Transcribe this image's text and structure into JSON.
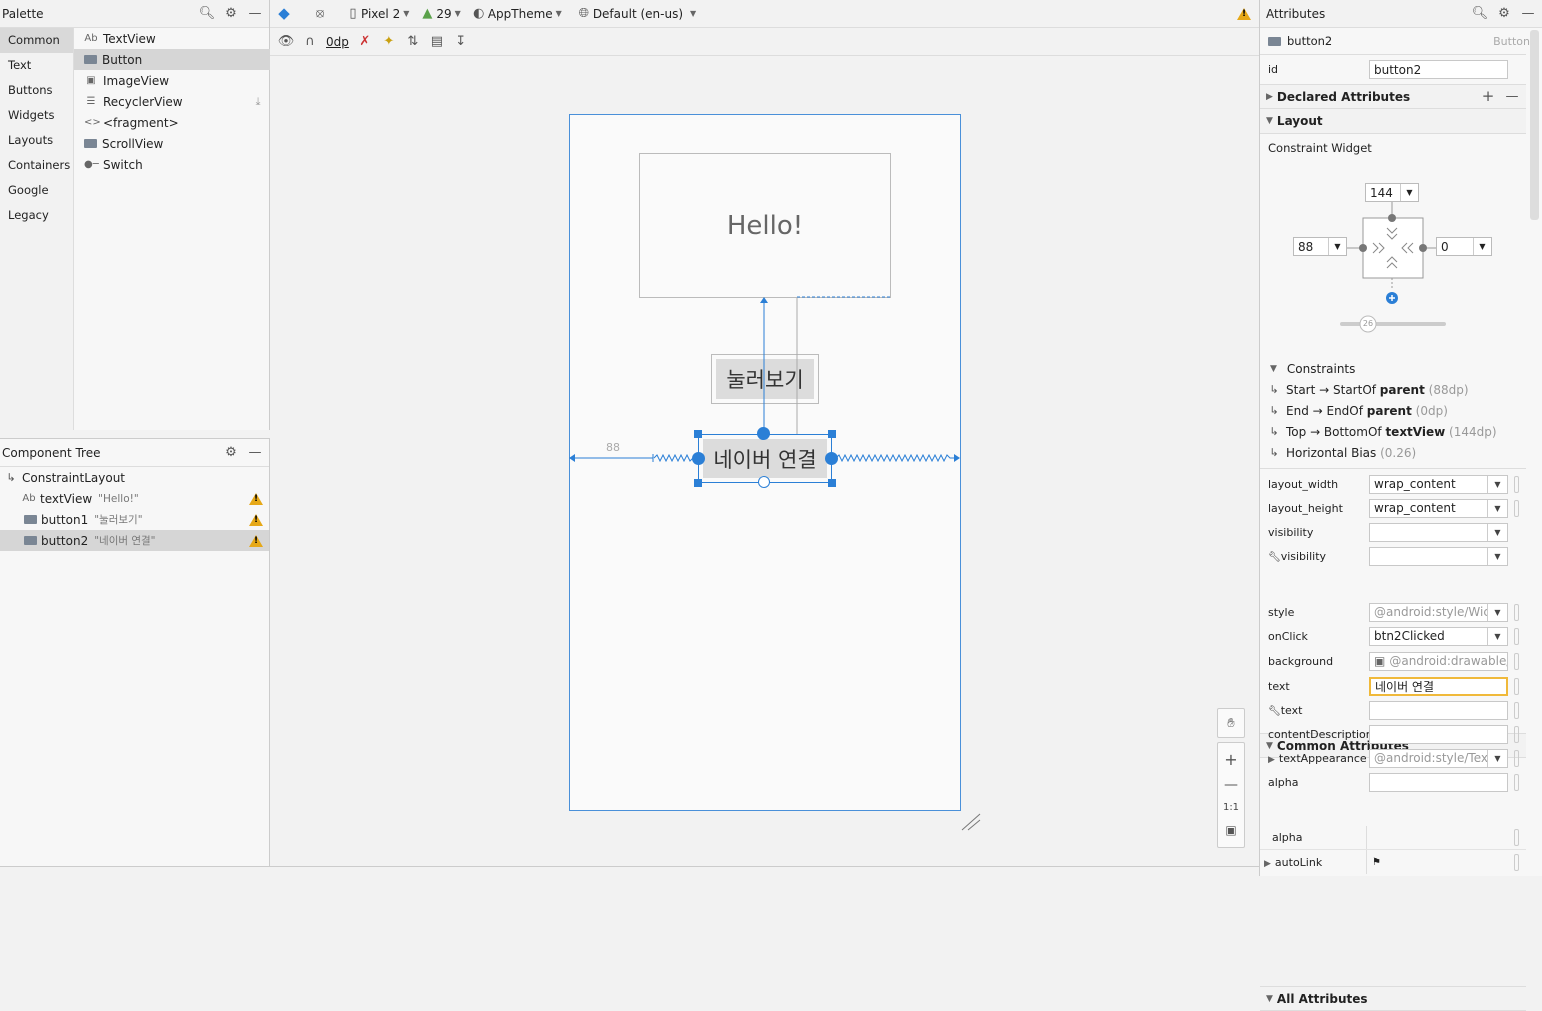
{
  "palette": {
    "title": "Palette",
    "categories": [
      "Common",
      "Text",
      "Buttons",
      "Widgets",
      "Layouts",
      "Containers",
      "Google",
      "Legacy"
    ],
    "items": [
      {
        "icon": "Ab",
        "label": "TextView"
      },
      {
        "icon": "button",
        "label": "Button"
      },
      {
        "icon": "image",
        "label": "ImageView"
      },
      {
        "icon": "list",
        "label": "RecyclerView"
      },
      {
        "icon": "code",
        "label": "<fragment>"
      },
      {
        "icon": "scroll",
        "label": "ScrollView"
      },
      {
        "icon": "switch",
        "label": "Switch"
      }
    ]
  },
  "tree": {
    "title": "Component Tree",
    "root": "ConstraintLayout",
    "rows": [
      {
        "icon": "Ab",
        "name": "textView",
        "text": "\"Hello!\""
      },
      {
        "icon": "button",
        "name": "button1",
        "text": "\"눌러보기\""
      },
      {
        "icon": "button",
        "name": "button2",
        "text": "\"네이버 연결\""
      }
    ]
  },
  "toolbar": {
    "device": "Pixel 2",
    "api": "29",
    "theme": "AppTheme",
    "locale": "Default (en-us)",
    "margin": "0dp"
  },
  "canvas": {
    "textview_text": "Hello!",
    "button1_text": "눌러보기",
    "button2_text": "네이버 연결",
    "margin_label": "88",
    "zoom_reset": "1:1"
  },
  "attributes": {
    "title": "Attributes",
    "selected_name": "button2",
    "selected_type": "Button",
    "id_label": "id",
    "id_value": "button2",
    "declared": "Declared Attributes",
    "layout": "Layout",
    "constraint_widget": "Constraint Widget",
    "top_margin": "144",
    "start_margin": "88",
    "end_margin": "0",
    "bias": "26",
    "constraints_title": "Constraints",
    "constraints": [
      {
        "pre": "Start → StartOf ",
        "target": "parent",
        "value": "(88dp)"
      },
      {
        "pre": "End → EndOf ",
        "target": "parent",
        "value": "(0dp)"
      },
      {
        "pre": "Top → BottomOf ",
        "target": "textView",
        "value": "(144dp)"
      },
      {
        "pre": "Horizontal Bias ",
        "target": "",
        "value": "(0.26)"
      }
    ],
    "layout_rows": [
      {
        "label": "layout_width",
        "value": "wrap_content"
      },
      {
        "label": "layout_height",
        "value": "wrap_content"
      },
      {
        "label": "visibility",
        "value": ""
      },
      {
        "label": "visibility",
        "value": ""
      }
    ],
    "common": "Common Attributes",
    "common_rows": [
      {
        "label": "style",
        "value": "@android:style/Wic"
      },
      {
        "label": "onClick",
        "value": "btn2Clicked"
      },
      {
        "label": "background",
        "value": "@android:drawable/b"
      },
      {
        "label": "text",
        "value": "네이버 연결"
      },
      {
        "label": "text",
        "value": ""
      },
      {
        "label": "contentDescription",
        "value": ""
      },
      {
        "label": "textAppearance",
        "value": "@android:style/Tex"
      },
      {
        "label": "alpha",
        "value": ""
      }
    ],
    "all": "All Attributes",
    "all_rows": [
      {
        "label": "alpha",
        "value": ""
      },
      {
        "label": "autoLink",
        "value": ""
      }
    ]
  }
}
